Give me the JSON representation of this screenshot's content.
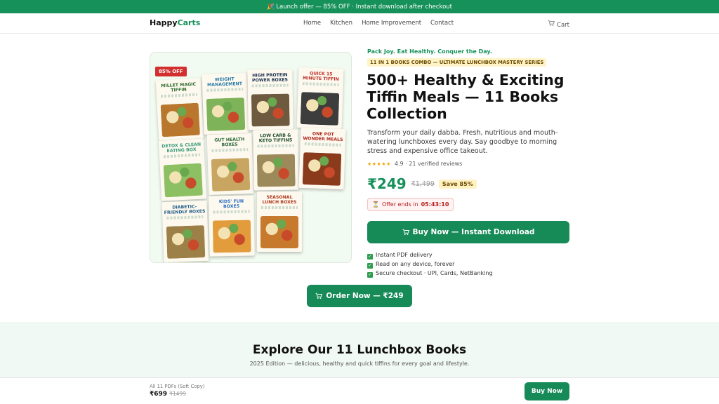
{
  "promo_bar": {
    "emoji": "🎉",
    "text": "Launch offer — 85% OFF · Instant download after checkout"
  },
  "nav": {
    "logo_main": "Happy",
    "logo_accent": "Carts",
    "links": [
      "Home",
      "Kitchen",
      "Home Improvement",
      "Contact"
    ],
    "cart_label": "Cart"
  },
  "product": {
    "discount_tag": "85% OFF",
    "tagline": "Pack Joy. Eat Healthy. Conquer the Day.",
    "combo_badge": "11 IN 1 BOOKS COMBO — ULTIMATE LUNCHBOX MASTERY SERIES",
    "title": "500+ Healthy & Exciting Tiffin Meals — 11 Books Collection",
    "description": "Transform your daily dabba. Fresh, nutritious and mouth-watering lunchboxes every day. Say goodbye to morning stress and expensive office takeout.",
    "rating_stars": "★★★★★",
    "rating_text": "4.9 · 21 verified reviews",
    "price": "₹249",
    "old_price": "₹1,499",
    "save_badge": "Save 85%",
    "offer_label": "Offer ends in",
    "offer_timer": "05:43:10",
    "buy_button": "Buy Now — Instant Download",
    "features": [
      "Instant PDF delivery",
      "Read on any device, forever",
      "Secure checkout · UPI, Cards, NetBanking"
    ],
    "books": [
      {
        "title": "MILLET MAGIC TIFFIN",
        "color": "#2e6b2e",
        "food": "#b9772d"
      },
      {
        "title": "WEIGHT MANAGEMENT",
        "color": "#2a7ba8",
        "food": "#7fb35a"
      },
      {
        "title": "HIGH PROTEIN POWER BOXES",
        "color": "#1b2f4e",
        "food": "#6e5a3f"
      },
      {
        "title": "QUICK 15 MINUTE TIFFIN",
        "color": "#c0312a",
        "food": "#3d3d3d"
      },
      {
        "title": "DETOX & CLEAN EATING BOX",
        "color": "#3b9a7c",
        "food": "#8cc063"
      },
      {
        "title": "GUT HEALTH BOXES",
        "color": "#2d6a3a",
        "food": "#c8a560"
      },
      {
        "title": "LOW CARB & KETO TIFFINS",
        "color": "#1f4f2d",
        "food": "#9c8a5a"
      },
      {
        "title": "ONE POT WONDER MEALS",
        "color": "#b0281e",
        "food": "#8a3b1c"
      },
      {
        "title": "DIABETIC-FRIENDLY BOXES",
        "color": "#25608a",
        "food": "#9d8047"
      },
      {
        "title": "KIDS' FUN BOXES",
        "color": "#2b6fc2",
        "food": "#e39c3b"
      },
      {
        "title": "SEASONAL LUNCH BOXES",
        "color": "#b03a1c",
        "food": "#c77a2e"
      }
    ]
  },
  "order_button": "Order Now — ₹249",
  "explore": {
    "title": "Explore Our 11 Lunchbox Books",
    "subtitle": "2025 Edition — delicious, healthy and quick tiffins for every goal and lifestyle."
  },
  "sticky": {
    "label": "All 11 PDFs (Soft Copy)",
    "price": "₹699",
    "old_price": "₹1499",
    "button": "Buy Now"
  }
}
